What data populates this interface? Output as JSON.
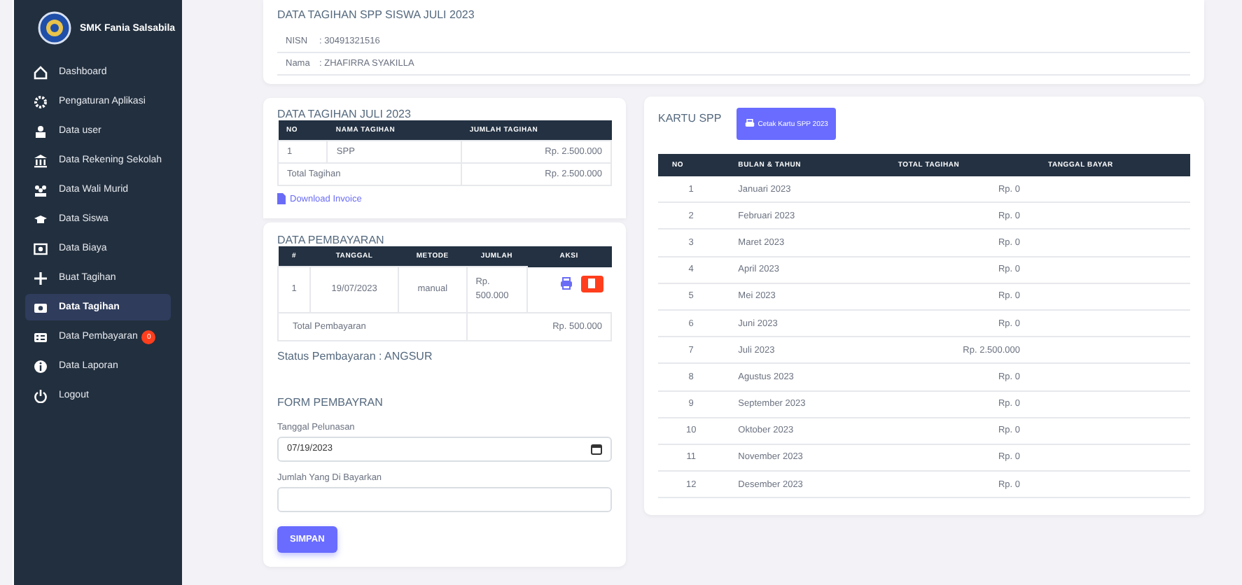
{
  "sidebar": {
    "brand": "SMK Fania Salsabila",
    "items": [
      {
        "label": "Dashboard",
        "selected": false
      },
      {
        "label": "Pengaturan Aplikasi",
        "selected": false
      },
      {
        "label": "Data user",
        "selected": false
      },
      {
        "label": "Data Rekening Sekolah",
        "selected": false
      },
      {
        "label": "Data Wali Murid",
        "selected": false
      },
      {
        "label": "Data Siswa",
        "selected": false
      },
      {
        "label": "Data Biaya",
        "selected": false
      },
      {
        "label": "Buat Tagihan",
        "selected": false
      },
      {
        "label": "Data Tagihan",
        "selected": true
      },
      {
        "label": "Data Pembayaran",
        "selected": false,
        "badge": "0"
      },
      {
        "label": "Data Laporan",
        "selected": false
      },
      {
        "label": "Logout",
        "selected": false
      }
    ]
  },
  "student": {
    "title": "DATA TAGIHAN SPP SISWA JULI 2023",
    "fields": [
      {
        "label": "NISN",
        "value": ": 30491321516"
      },
      {
        "label": "Nama",
        "value": ": ZHAFIRRA SYAKILLA"
      }
    ]
  },
  "bill": {
    "title": "DATA TAGIHAN JULI 2023",
    "columns": [
      "NO",
      "NAMA TAGIHAN",
      "JUMLAH TAGIHAN"
    ],
    "rows": [
      [
        "1",
        "SPP",
        "Rp. 2.500.000"
      ]
    ],
    "total_label": "Total Tagihan",
    "total_value": "Rp. 2.500.000",
    "download": "Download Invoice"
  },
  "payments": {
    "title": "DATA PEMBAYARAN",
    "columns": [
      "#",
      "TANGGAL",
      "METODE",
      "JUMLAH",
      "AKSI"
    ],
    "rows": [
      [
        "1",
        "19/07/2023",
        "manual",
        "Rp. 500.000"
      ]
    ],
    "total_label": "Total Pembayaran",
    "total_value": "Rp. 500.000",
    "status": "Status Pembayaran : ANGSUR"
  },
  "form": {
    "title": "FORM PEMBAYRAN",
    "date_label": "Tanggal Pelunasan",
    "date_value": "07/19/2023",
    "amount_label": "Jumlah Yang Di Bayarkan",
    "submit": "SIMPAN"
  },
  "card": {
    "title": "KARTU SPP",
    "print_button": "Cetak Kartu SPP 2023",
    "columns": [
      "NO",
      "BULAN & TAHUN",
      "TOTAL TAGIHAN",
      "TANGGAL BAYAR"
    ],
    "rows": [
      [
        "1",
        "Januari 2023",
        "Rp. 0"
      ],
      [
        "2",
        "Februari 2023",
        "Rp. 0"
      ],
      [
        "3",
        "Maret 2023",
        "Rp. 0"
      ],
      [
        "4",
        "April 2023",
        "Rp. 0"
      ],
      [
        "5",
        "Mei 2023",
        "Rp. 0"
      ],
      [
        "6",
        "Juni 2023",
        "Rp. 0"
      ],
      [
        "7",
        "Juli 2023",
        "Rp. 2.500.000"
      ],
      [
        "8",
        "Agustus 2023",
        "Rp. 0"
      ],
      [
        "9",
        "September 2023",
        "Rp. 0"
      ],
      [
        "10",
        "Oktober 2023",
        "Rp. 0"
      ],
      [
        "11",
        "November 2023",
        "Rp. 0"
      ],
      [
        "12",
        "Desember 2023",
        "Rp. 0"
      ]
    ]
  }
}
